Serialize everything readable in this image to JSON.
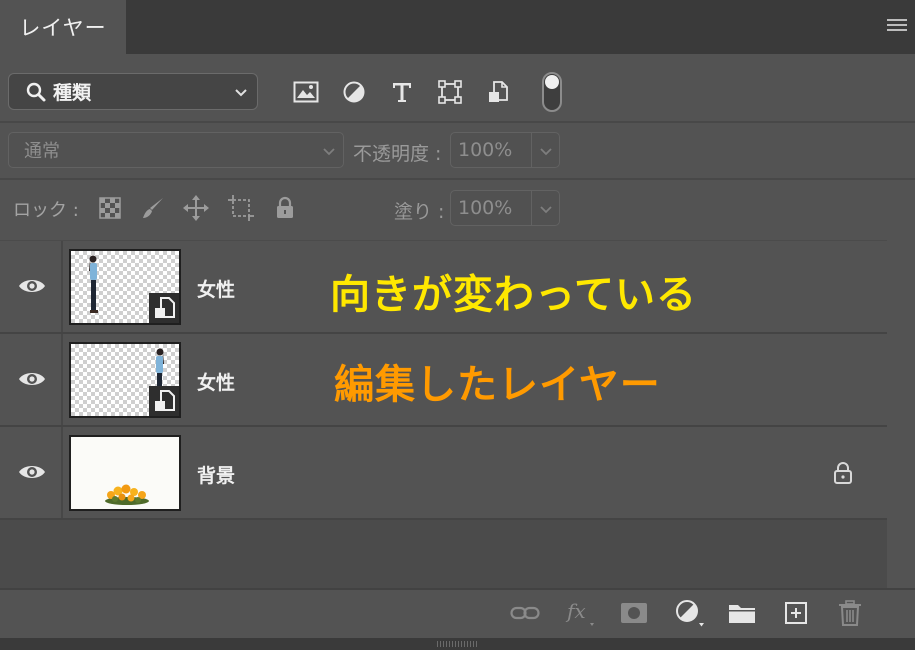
{
  "panel": {
    "tab_label": "レイヤー"
  },
  "filter": {
    "kind_label": "種類"
  },
  "blend": {
    "mode_label": "通常",
    "opacity_label": "不透明度 :",
    "opacity_value": "100%"
  },
  "lock": {
    "label": "ロック :",
    "fill_label": "塗り :",
    "fill_value": "100%"
  },
  "layers": [
    {
      "name": "女性",
      "visible": true,
      "smart_object": true,
      "thumbnail": "woman-facing-right"
    },
    {
      "name": "女性",
      "visible": true,
      "smart_object": true,
      "thumbnail": "woman-facing-left"
    },
    {
      "name": "背景",
      "visible": true,
      "locked": true,
      "thumbnail": "flowers-on-white"
    }
  ],
  "annotations": {
    "first": "向きが変わっている",
    "second": "編集したレイヤー"
  },
  "colors": {
    "annotation_yellow": "#ffe800",
    "annotation_orange": "#ff9a00",
    "panel_bg": "#535353"
  }
}
